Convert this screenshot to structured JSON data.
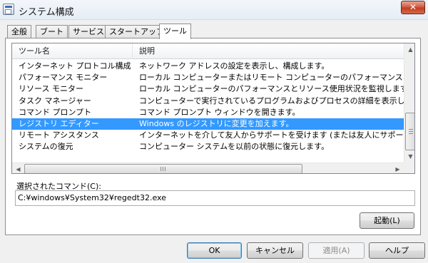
{
  "window": {
    "title": "システム構成",
    "close_glyph": "✕"
  },
  "tabs": [
    {
      "label": "全般"
    },
    {
      "label": "ブート"
    },
    {
      "label": "サービス"
    },
    {
      "label": "スタートアップ"
    },
    {
      "label": "ツール",
      "active": true
    }
  ],
  "tools_list": {
    "columns": [
      "ツール名",
      "説明"
    ],
    "rows": [
      {
        "name": "インターネット プロトコル構成",
        "desc": "ネットワーク アドレスの設定を表示し、構成します。"
      },
      {
        "name": "パフォーマンス モニター",
        "desc": "ローカル コンピューターまたはリモート コンピューターのパフォーマンスを監視します"
      },
      {
        "name": "リソース モニター",
        "desc": "ローカル コンピューターのパフォーマンスとリソース使用状況を監視します。"
      },
      {
        "name": "タスク マネージャー",
        "desc": "コンピューターで実行されているプログラムおよびプロセスの詳細を表示します"
      },
      {
        "name": "コマンド プロンプト",
        "desc": "コマンド プロンプト ウィンドウを開きます。"
      },
      {
        "name": "レジストリ エディター",
        "desc": "Windows のレジストリに変更を加えます。",
        "selected": true
      },
      {
        "name": "リモート アシスタンス",
        "desc": "インターネットを介して友人からサポートを受けます (または友人にサポートを提供します)"
      },
      {
        "name": "システムの復元",
        "desc": "コンピューター システムを以前の状態に復元します。"
      }
    ],
    "scroll_up_glyph": "▲",
    "scroll_down_glyph": "▼",
    "scroll_left_glyph": "◀",
    "scroll_right_glyph": "▶"
  },
  "command": {
    "label": "選択されたコマンド(C):",
    "value": "C:¥windows¥System32¥regedt32.exe"
  },
  "buttons": {
    "launch": "起動(L)",
    "ok": "OK",
    "cancel": "キャンセル",
    "apply": "適用(A)",
    "help": "ヘルプ"
  },
  "colors": {
    "selection": "#3399ff",
    "close_button": "#c8432a"
  }
}
